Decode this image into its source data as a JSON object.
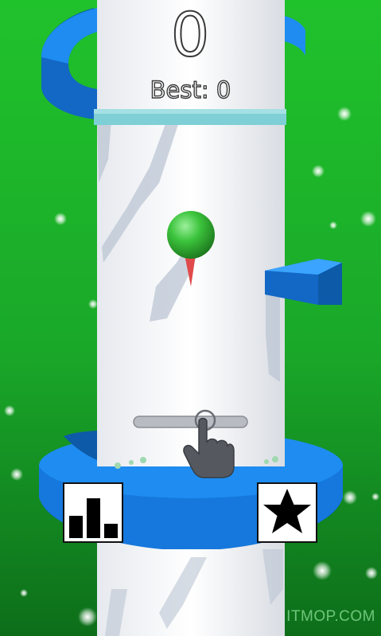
{
  "hud": {
    "score": "0",
    "best_label": "Best:",
    "best_value": "0"
  },
  "buttons": {
    "leaderboard_icon": "bar-chart-icon",
    "rate_icon": "star-icon"
  },
  "watermark": "ITMOP.COM",
  "colors": {
    "background": "#1bbd2a",
    "tower": "#f2f4f6",
    "platform": "#1e8cf0",
    "ball": "#3cc43c",
    "trail": "#e04a4a"
  }
}
